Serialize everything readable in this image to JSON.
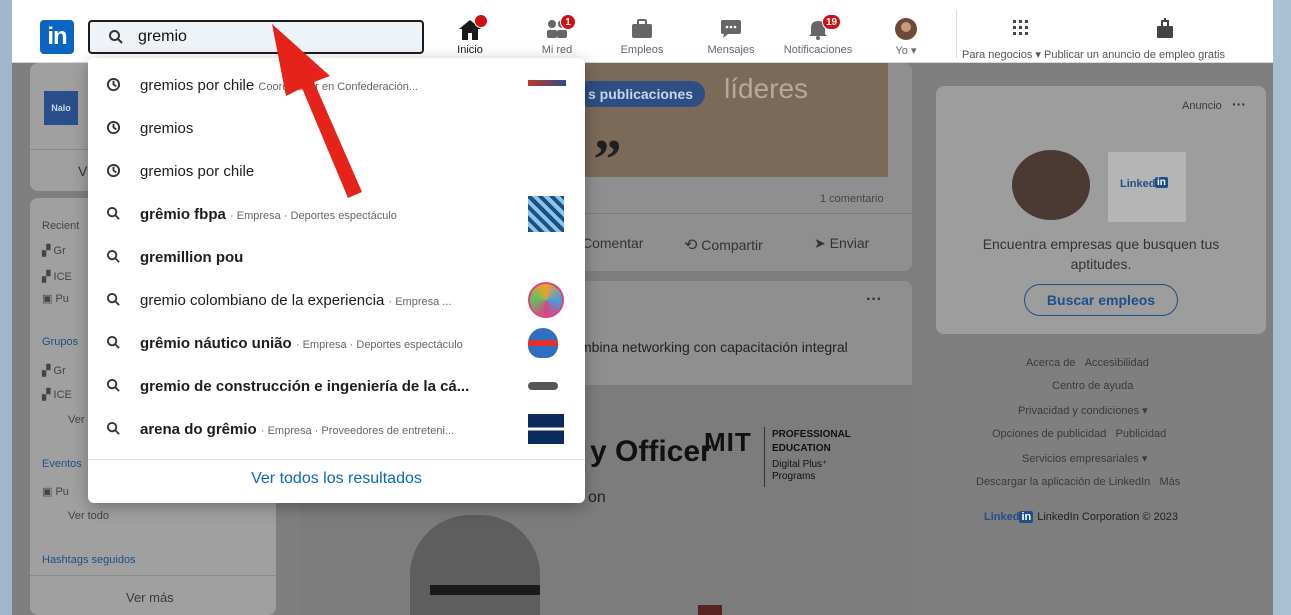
{
  "search": {
    "value": "gremio"
  },
  "nav": {
    "home": "Inicio",
    "network": "Mi red",
    "network_badge": "1",
    "jobs": "Empleos",
    "messages": "Mensajes",
    "notifications": "Notificaciones",
    "notifications_badge": "19",
    "me": "Yo",
    "business": "Para negocios",
    "post_job": "Publicar un anuncio de empleo gratis"
  },
  "dropdown": {
    "items": [
      {
        "type": "history",
        "text": "gremios por chile",
        "sub": "Coordinador en Confederación...",
        "icon": "clock-icon",
        "thumb": "logo-text"
      },
      {
        "type": "history",
        "text": "gremios",
        "sub": "",
        "icon": "clock-icon"
      },
      {
        "type": "history",
        "text": "gremios por chile",
        "sub": "",
        "icon": "clock-icon"
      },
      {
        "type": "search",
        "text": "grêmio fbpa",
        "sub": "· Empresa · Deportes espectáculo",
        "icon": "search-icon",
        "thumb": "gremio-logo"
      },
      {
        "type": "search",
        "text": "gremillion pou",
        "sub": "",
        "icon": "search-icon"
      },
      {
        "type": "search",
        "text": "gremio colombiano de la experiencia",
        "sub": "· Empresa ...",
        "icon": "search-icon",
        "thumb": "colorful-logo"
      },
      {
        "type": "search",
        "text": "grêmio náutico união",
        "sub": "· Empresa · Deportes espectáculo",
        "icon": "search-icon",
        "thumb": "gnu-logo"
      },
      {
        "type": "search",
        "text": "gremio de construcción e ingeniería de la cá...",
        "sub": "",
        "icon": "search-icon",
        "thumb": "small-logo"
      },
      {
        "type": "search",
        "text": "arena do grêmio",
        "sub": "· Empresa · Proveedores de entreteni...",
        "icon": "search-icon",
        "thumb": "arena-logo"
      }
    ],
    "see_all": "Ver todos los resultados"
  },
  "left": {
    "recent": "Recient",
    "recent_items": [
      "Gr",
      "ICE",
      "Pu"
    ],
    "groups": "Grupos",
    "group_items": [
      "Gr",
      "ICE"
    ],
    "group_more": "Ver",
    "events": "Eventos",
    "event_items": [
      "Pu"
    ],
    "see_all": "Ver todo",
    "hashtags": "Hashtags seguidos",
    "see_more": "Ver más",
    "profile_v": "V",
    "logo_text": "Nalo"
  },
  "feed": {
    "tag": "s publicaciones",
    "banner_text": "líderes",
    "quote": "„",
    "comments": "1 comentario",
    "comment": "Comentar",
    "share": "Compartir",
    "send": "Enviar",
    "more": "···",
    "snippet": "mbina networking con capacitación integral",
    "officer": "y Officer",
    "officer_sub": "on",
    "mit": "MIT",
    "pe_line1": "PROFESSIONAL",
    "pe_line2": "EDUCATION",
    "pe_line3": "Digital Plus⁺",
    "pe_line4": "Programs"
  },
  "right": {
    "ad": "Anuncio",
    "ad_more": "···",
    "linkedin": "Linked",
    "linkedin_in": "in",
    "message": "Encuentra empresas que busquen tus aptitudes.",
    "button": "Buscar empleos",
    "footer": [
      [
        "Acerca de",
        "Accesibilidad"
      ],
      [
        "Centro de ayuda"
      ],
      [
        "Privacidad y condiciones ▾"
      ],
      [
        "Opciones de publicidad",
        "Publicidad"
      ],
      [
        "Servicios empresariales ▾"
      ],
      [
        "Descargar la aplicación de LinkedIn",
        "Más"
      ]
    ],
    "corp_brand": "Linked",
    "corp_brand_in": "in",
    "corp": "LinkedIn Corporation © 2023"
  },
  "colors": {
    "brand": "#0a66c2",
    "badge": "#cc1016",
    "arrow": "#e5231b"
  }
}
